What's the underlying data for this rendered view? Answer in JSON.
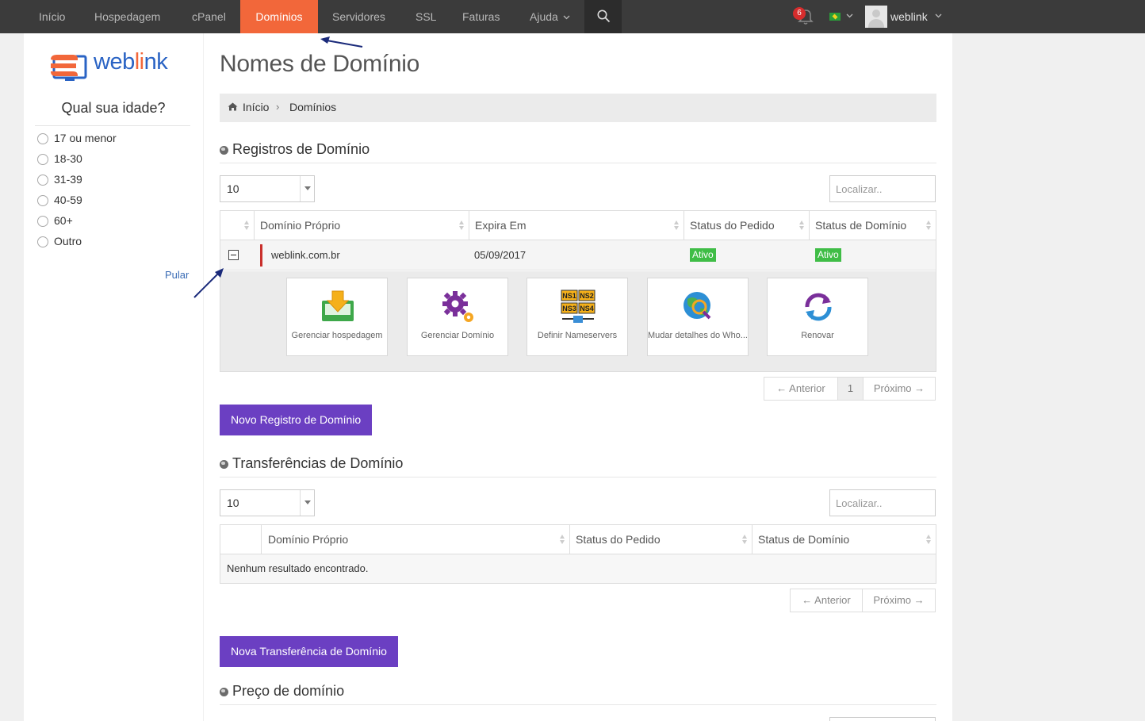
{
  "nav": {
    "items": [
      {
        "label": "Início"
      },
      {
        "label": "Hospedagem"
      },
      {
        "label": "cPanel"
      },
      {
        "label": "Domínios"
      },
      {
        "label": "Servidores"
      },
      {
        "label": "SSL"
      },
      {
        "label": "Faturas"
      },
      {
        "label": "Ajuda"
      }
    ],
    "active_index": 3,
    "notification_count": "6",
    "username": "weblink"
  },
  "sidebar": {
    "logo_text": "weblink",
    "poll": {
      "title": "Qual sua idade?",
      "options": [
        "17 ou menor",
        "18-30",
        "31-39",
        "40-59",
        "60+",
        "Outro"
      ]
    },
    "skip_link": "Pular"
  },
  "page": {
    "title": "Nomes de Domínio",
    "breadcrumb": {
      "home": "Início",
      "current": "Domínios"
    }
  },
  "registrations": {
    "title": "Registros de Domínio",
    "page_size": "10",
    "search_placeholder": "Localizar..",
    "columns": [
      "Domínio Próprio",
      "Expira Em",
      "Status do Pedido",
      "Status de Domínio"
    ],
    "rows": [
      {
        "domain": "weblink.com.br",
        "expires": "05/09/2017",
        "order_status": "Ativo",
        "domain_status": "Ativo"
      }
    ],
    "actions": [
      {
        "label": "Gerenciar hospedagem",
        "icon": "download-tray-icon"
      },
      {
        "label": "Gerenciar Domínio",
        "icon": "gears-icon"
      },
      {
        "label": "Definir Nameservers",
        "icon": "nameservers-icon"
      },
      {
        "label": "Mudar detalhes do Who...",
        "icon": "globe-magnifier-icon"
      },
      {
        "label": "Renovar",
        "icon": "renew-arrows-icon"
      }
    ],
    "pager": {
      "prev": "← Anterior",
      "page": "1",
      "next": "Próximo →"
    },
    "new_button": "Novo Registro de Domínio"
  },
  "transfers": {
    "title": "Transferências de Domínio",
    "page_size": "10",
    "search_placeholder": "Localizar..",
    "columns": [
      "Domínio Próprio",
      "Status do Pedido",
      "Status de Domínio"
    ],
    "empty_text": "Nenhum resultado encontrado.",
    "pager": {
      "prev": "← Anterior",
      "next": "Próximo →"
    },
    "new_button": "Nova Transferência de Domínio"
  },
  "pricing": {
    "title": "Preço de domínio"
  },
  "colors": {
    "nav_bg": "#3b3b3b",
    "active_tab": "#f2673a",
    "primary_button": "#6b3fc2",
    "status_active": "#3fbd46",
    "annotation_arrow": "#1a2a7a"
  }
}
